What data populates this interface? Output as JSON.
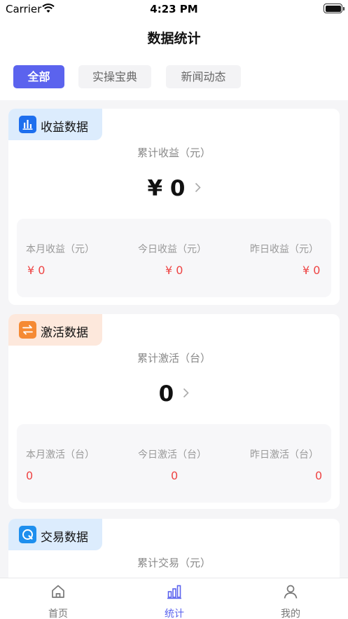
{
  "status_bar": {
    "carrier": "Carrier",
    "time": "4:23 PM"
  },
  "nav": {
    "title": "数据统计"
  },
  "tabs": [
    {
      "label": "全部",
      "active": true
    },
    {
      "label": "实操宝典",
      "active": false
    },
    {
      "label": "新闻动态",
      "active": false
    }
  ],
  "cards": {
    "income": {
      "title": "收益数据",
      "icon": "bar-chart-icon",
      "color": "#1e6fee",
      "tag_bg": "#dcecfd",
      "total_label": "累计收益（元）",
      "total_value": "¥ 0",
      "items": [
        {
          "label": "本月收益（元）",
          "value": "¥ 0"
        },
        {
          "label": "今日收益（元）",
          "value": "¥ 0"
        },
        {
          "label": "昨日收益（元）",
          "value": "¥ 0"
        }
      ]
    },
    "activation": {
      "title": "激活数据",
      "icon": "swap-arrows-icon",
      "color": "#f58a34",
      "tag_bg": "#fde8dc",
      "total_label": "累计激活（台）",
      "total_value": "0",
      "items": [
        {
          "label": "本月激活（台）",
          "value": "0"
        },
        {
          "label": "今日激活（台）",
          "value": "0"
        },
        {
          "label": "昨日激活（台）",
          "value": "0"
        }
      ]
    },
    "transaction": {
      "title": "交易数据",
      "icon": "q-circle-icon",
      "color": "#1e8fee",
      "tag_bg": "#dcecfd",
      "total_label": "累计交易（元）"
    }
  },
  "tab_bar": [
    {
      "label": "首页",
      "icon": "home-icon",
      "active": false
    },
    {
      "label": "统计",
      "icon": "stats-icon",
      "active": true
    },
    {
      "label": "我的",
      "icon": "person-icon",
      "active": false
    }
  ],
  "colors": {
    "accent": "#5b63ee",
    "value_red": "#ee4444"
  }
}
